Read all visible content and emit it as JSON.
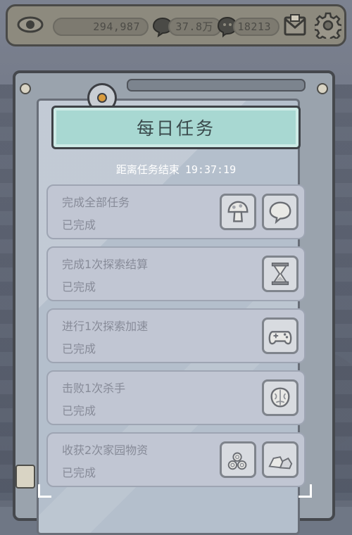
{
  "topbar": {
    "eye_icon": "eye-icon",
    "resources": [
      {
        "name": "coins",
        "value": "294,987"
      },
      {
        "name": "speech-bubble-currency",
        "value": "37.8万",
        "icon": "speech-bubble-icon"
      },
      {
        "name": "ghost-currency",
        "value": "18213",
        "icon": "ghost-bubble-icon"
      }
    ],
    "mail_icon": "mail-icon",
    "settings_icon": "gear-icon"
  },
  "panel": {
    "title": "每日任务",
    "timer_label": "距离任务结束",
    "timer_value": "19:37:19"
  },
  "tasks": [
    {
      "title": "完成全部任务",
      "status": "已完成",
      "rewards": [
        "mushroom-icon",
        "speech-bubble-icon"
      ]
    },
    {
      "title": "完成1次探索结算",
      "status": "已完成",
      "rewards": [
        "hourglass-icon"
      ]
    },
    {
      "title": "进行1次探索加速",
      "status": "已完成",
      "rewards": [
        "gamepad-icon"
      ]
    },
    {
      "title": "击败1次杀手",
      "status": "已完成",
      "rewards": [
        "brain-icon"
      ]
    },
    {
      "title": "收获2次家园物资",
      "status": "已完成",
      "rewards": [
        "wood-logs-icon",
        "stones-icon"
      ]
    }
  ],
  "colors": {
    "title_plate": "#a8d8d2",
    "card_bg": "#c1c6d3",
    "panel_frame": "#45484d",
    "timer_text": "#ffffff"
  }
}
